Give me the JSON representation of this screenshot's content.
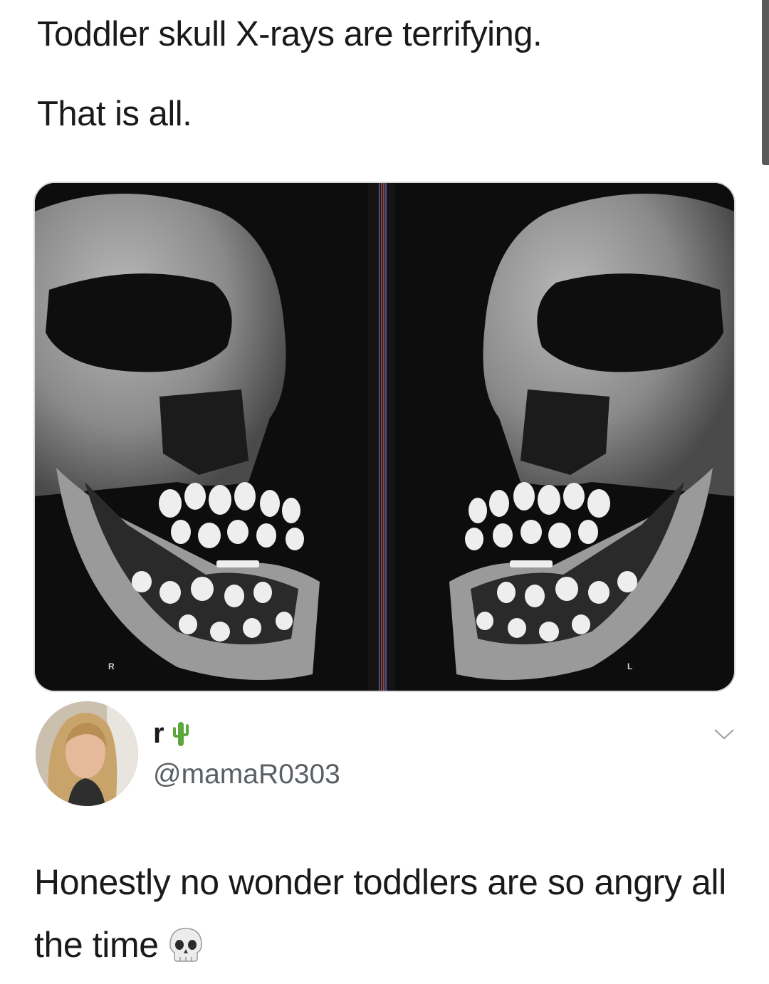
{
  "post": {
    "line1": "Toddler skull X-rays are terrifying.",
    "line2": "That is all."
  },
  "media": {
    "marker_left": "R",
    "marker_right": "L"
  },
  "reply": {
    "display_name": "r",
    "name_emoji": "cactus-icon",
    "handle": "@mamaR0303",
    "text": "Honestly no wonder toddlers are so angry all the time",
    "text_emoji": "skull-icon"
  },
  "colors": {
    "text": "#1a1a1a",
    "handle": "#5a5f63",
    "xray_bg": "#0b0b0b",
    "cactus": "#5aa83b"
  }
}
